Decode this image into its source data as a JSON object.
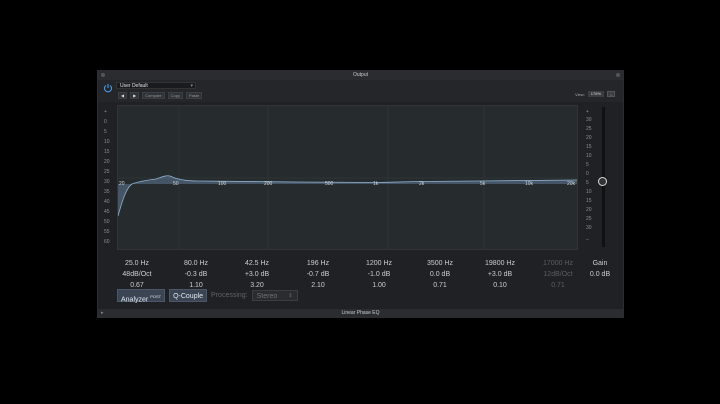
{
  "window": {
    "title": "Output",
    "plugin_name": "Linear Phase EQ"
  },
  "header": {
    "preset": "User Default",
    "buttons": {
      "compare": "Compare",
      "copy": "Copy",
      "paste": "Paste"
    },
    "view_label": "View:",
    "view_value": "176%"
  },
  "graph": {
    "db_scale_left": [
      "+",
      "0",
      "5",
      "10",
      "15",
      "20",
      "25",
      "30",
      "35",
      "40",
      "45",
      "50",
      "55",
      "60"
    ],
    "db_scale_right": [
      "+",
      "30",
      "25",
      "20",
      "15",
      "10",
      "5",
      "0",
      "5",
      "10",
      "15",
      "20",
      "25",
      "30",
      "–"
    ],
    "freq_labels": [
      "20",
      "50",
      "100",
      "200",
      "500",
      "1k",
      "2k",
      "5k",
      "10k",
      "20k"
    ],
    "band_icons": [
      "lowcut-icon",
      "lowshelf-icon",
      "bell-icon",
      "bell-icon",
      "bell-icon",
      "bell-icon",
      "highshelf-icon",
      "highcut-icon"
    ]
  },
  "bands": [
    {
      "freq": "25.0 Hz",
      "gain": "48dB/Oct",
      "q": "0.67",
      "active": true
    },
    {
      "freq": "80.0 Hz",
      "gain": "-0.3 dB",
      "q": "1.10",
      "active": true
    },
    {
      "freq": "42.5 Hz",
      "gain": "+3.0 dB",
      "q": "3.20",
      "active": true
    },
    {
      "freq": "196 Hz",
      "gain": "-0.7 dB",
      "q": "2.10",
      "active": true
    },
    {
      "freq": "1200 Hz",
      "gain": "-1.0 dB",
      "q": "1.00",
      "active": true
    },
    {
      "freq": "3500 Hz",
      "gain": "0.0 dB",
      "q": "0.71",
      "active": true
    },
    {
      "freq": "19800 Hz",
      "gain": "+3.0 dB",
      "q": "0.10",
      "active": true
    },
    {
      "freq": "17000 Hz",
      "gain": "12dB/Oct",
      "q": "0.71",
      "active": false
    }
  ],
  "gain": {
    "label": "Gain",
    "value": "0.0 dB"
  },
  "controls": {
    "analyzer": "Analyzer",
    "analyzer_mode": "POST",
    "qcouple": "Q-Couple",
    "processing_label": "Processing:",
    "processing_value": "Stereo"
  }
}
